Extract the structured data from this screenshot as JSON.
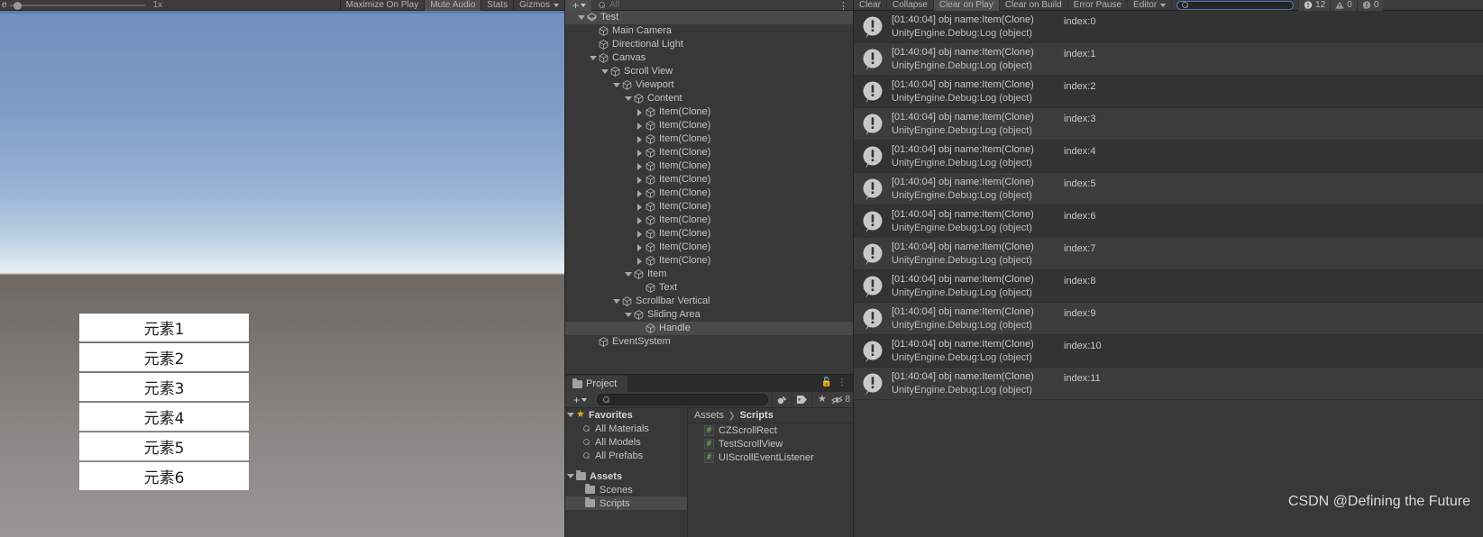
{
  "game_view": {
    "toolbar": {
      "scale_label": "e",
      "scale_value": "1x",
      "maximize_on_play": "Maximize On Play",
      "mute_audio": "Mute Audio",
      "stats": "Stats",
      "gizmos": "Gizmos"
    },
    "items": [
      "元素1",
      "元素2",
      "元素3",
      "元素4",
      "元素5",
      "元素6"
    ]
  },
  "hierarchy": {
    "toolbar": {
      "search_placeholder": "All",
      "add_label": "+"
    },
    "rows": [
      {
        "label": "Test",
        "indent": 0,
        "foldout": "down",
        "icon": "scene-icon",
        "selected": true
      },
      {
        "label": "Main Camera",
        "indent": 1,
        "foldout": "none",
        "icon": "gameobject-icon",
        "selected": false
      },
      {
        "label": "Directional Light",
        "indent": 1,
        "foldout": "none",
        "icon": "gameobject-icon",
        "selected": false
      },
      {
        "label": "Canvas",
        "indent": 1,
        "foldout": "down",
        "icon": "gameobject-icon",
        "selected": false
      },
      {
        "label": "Scroll View",
        "indent": 2,
        "foldout": "down",
        "icon": "gameobject-icon",
        "selected": false
      },
      {
        "label": "Viewport",
        "indent": 3,
        "foldout": "down",
        "icon": "gameobject-icon",
        "selected": false
      },
      {
        "label": "Content",
        "indent": 4,
        "foldout": "down",
        "icon": "gameobject-icon",
        "selected": false
      },
      {
        "label": "Item(Clone)",
        "indent": 5,
        "foldout": "right",
        "icon": "gameobject-icon",
        "selected": false
      },
      {
        "label": "Item(Clone)",
        "indent": 5,
        "foldout": "right",
        "icon": "gameobject-icon",
        "selected": false
      },
      {
        "label": "Item(Clone)",
        "indent": 5,
        "foldout": "right",
        "icon": "gameobject-icon",
        "selected": false
      },
      {
        "label": "Item(Clone)",
        "indent": 5,
        "foldout": "right",
        "icon": "gameobject-icon",
        "selected": false
      },
      {
        "label": "Item(Clone)",
        "indent": 5,
        "foldout": "right",
        "icon": "gameobject-icon",
        "selected": false
      },
      {
        "label": "Item(Clone)",
        "indent": 5,
        "foldout": "right",
        "icon": "gameobject-icon",
        "selected": false
      },
      {
        "label": "Item(Clone)",
        "indent": 5,
        "foldout": "right",
        "icon": "gameobject-icon",
        "selected": false
      },
      {
        "label": "Item(Clone)",
        "indent": 5,
        "foldout": "right",
        "icon": "gameobject-icon",
        "selected": false
      },
      {
        "label": "Item(Clone)",
        "indent": 5,
        "foldout": "right",
        "icon": "gameobject-icon",
        "selected": false
      },
      {
        "label": "Item(Clone)",
        "indent": 5,
        "foldout": "right",
        "icon": "gameobject-icon",
        "selected": false
      },
      {
        "label": "Item(Clone)",
        "indent": 5,
        "foldout": "right",
        "icon": "gameobject-icon",
        "selected": false
      },
      {
        "label": "Item(Clone)",
        "indent": 5,
        "foldout": "right",
        "icon": "gameobject-icon",
        "selected": false
      },
      {
        "label": "Item",
        "indent": 4,
        "foldout": "down",
        "icon": "gameobject-icon",
        "selected": false
      },
      {
        "label": "Text",
        "indent": 5,
        "foldout": "none",
        "icon": "gameobject-icon",
        "selected": false
      },
      {
        "label": "Scrollbar Vertical",
        "indent": 3,
        "foldout": "down",
        "icon": "gameobject-icon",
        "selected": false
      },
      {
        "label": "Sliding Area",
        "indent": 4,
        "foldout": "down",
        "icon": "gameobject-icon",
        "selected": false
      },
      {
        "label": "Handle",
        "indent": 5,
        "foldout": "none",
        "icon": "gameobject-icon",
        "selected": true
      },
      {
        "label": "EventSystem",
        "indent": 1,
        "foldout": "none",
        "icon": "gameobject-icon",
        "selected": false
      }
    ]
  },
  "project": {
    "tab_label": "Project",
    "search_placeholder": "",
    "badge_count": "8",
    "favorites": {
      "label": "Favorites",
      "items": [
        "All Materials",
        "All Models",
        "All Prefabs"
      ]
    },
    "assets": {
      "label": "Assets",
      "items": [
        {
          "label": "Scenes",
          "selected": false
        },
        {
          "label": "Scripts",
          "selected": true
        }
      ]
    },
    "breadcrumb": {
      "root": "Assets",
      "current": "Scripts"
    },
    "files": [
      "CZScrollRect",
      "TestScrollView",
      "UIScrollEventListener"
    ]
  },
  "console": {
    "toolbar": {
      "clear": "Clear",
      "collapse": "Collapse",
      "clear_on_play": "Clear on Play",
      "clear_on_build": "Clear on Build",
      "error_pause": "Error Pause",
      "editor": "Editor",
      "search_placeholder": ""
    },
    "counters": {
      "log": "12",
      "warning": "0",
      "error": "0"
    },
    "entries": [
      {
        "time": "[01:40:04]",
        "message": "obj name:Item(Clone)",
        "index": "index:0",
        "stack": "UnityEngine.Debug:Log (object)"
      },
      {
        "time": "[01:40:04]",
        "message": "obj name:Item(Clone)",
        "index": "index:1",
        "stack": "UnityEngine.Debug:Log (object)"
      },
      {
        "time": "[01:40:04]",
        "message": "obj name:Item(Clone)",
        "index": "index:2",
        "stack": "UnityEngine.Debug:Log (object)"
      },
      {
        "time": "[01:40:04]",
        "message": "obj name:Item(Clone)",
        "index": "index:3",
        "stack": "UnityEngine.Debug:Log (object)"
      },
      {
        "time": "[01:40:04]",
        "message": "obj name:Item(Clone)",
        "index": "index:4",
        "stack": "UnityEngine.Debug:Log (object)"
      },
      {
        "time": "[01:40:04]",
        "message": "obj name:Item(Clone)",
        "index": "index:5",
        "stack": "UnityEngine.Debug:Log (object)"
      },
      {
        "time": "[01:40:04]",
        "message": "obj name:Item(Clone)",
        "index": "index:6",
        "stack": "UnityEngine.Debug:Log (object)"
      },
      {
        "time": "[01:40:04]",
        "message": "obj name:Item(Clone)",
        "index": "index:7",
        "stack": "UnityEngine.Debug:Log (object)"
      },
      {
        "time": "[01:40:04]",
        "message": "obj name:Item(Clone)",
        "index": "index:8",
        "stack": "UnityEngine.Debug:Log (object)"
      },
      {
        "time": "[01:40:04]",
        "message": "obj name:Item(Clone)",
        "index": "index:9",
        "stack": "UnityEngine.Debug:Log (object)"
      },
      {
        "time": "[01:40:04]",
        "message": "obj name:Item(Clone)",
        "index": "index:10",
        "stack": "UnityEngine.Debug:Log (object)"
      },
      {
        "time": "[01:40:04]",
        "message": "obj name:Item(Clone)",
        "index": "index:11",
        "stack": "UnityEngine.Debug:Log (object)"
      }
    ]
  },
  "watermark": "CSDN @Defining the Future",
  "colors": {
    "panel_bg": "#383838",
    "toolbar_bg": "#3c3c3c",
    "selection": "#4a4a4a",
    "accent_blue": "#5c7cb0",
    "script_green": "#6cc04a",
    "favorite_gold": "#d8b021"
  }
}
